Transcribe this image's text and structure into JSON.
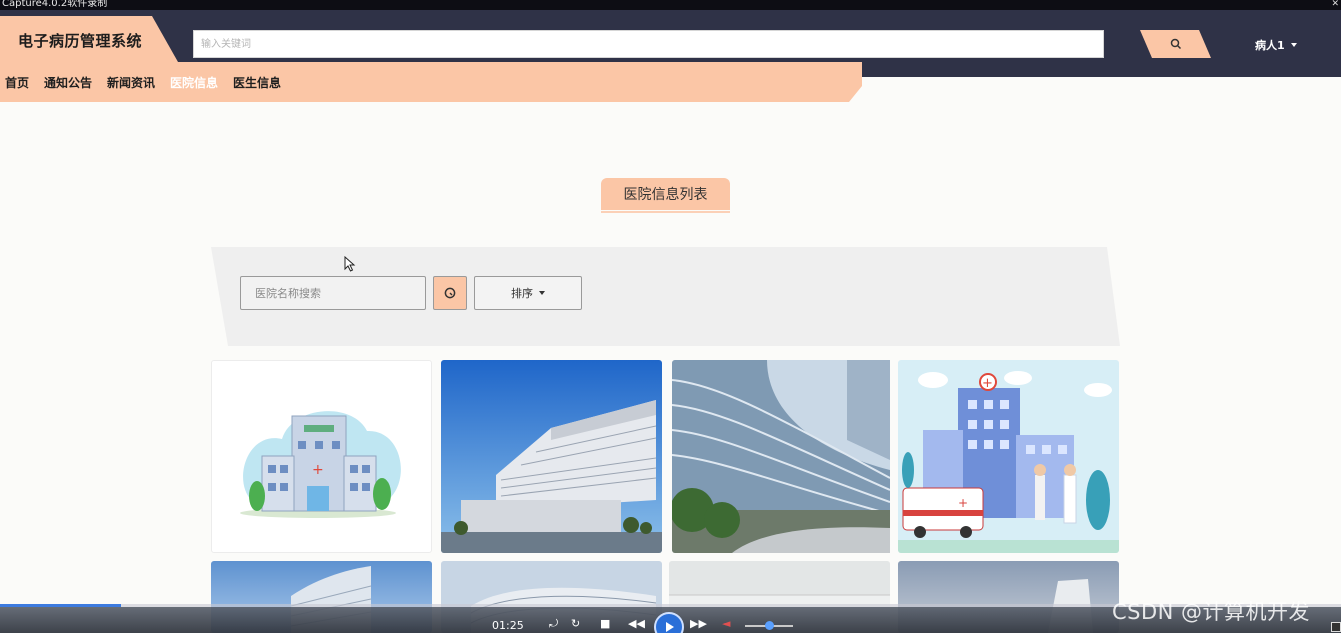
{
  "capture": {
    "title": "Capture4.0.2软件录制"
  },
  "header": {
    "brand": "电子病历管理系统",
    "search_placeholder": "输入关键词",
    "user": "病人1"
  },
  "nav": {
    "items": [
      {
        "label": "首页"
      },
      {
        "label": "通知公告"
      },
      {
        "label": "新闻资讯"
      },
      {
        "label": "医院信息",
        "active": true
      },
      {
        "label": "医生信息"
      }
    ]
  },
  "section": {
    "title": "医院信息列表"
  },
  "filter": {
    "name_placeholder": "医院名称搜索",
    "sort_label": "排序"
  },
  "cards": [
    {
      "icon": "hospital-cartoon-icon"
    },
    {
      "icon": "hospital-building-photo"
    },
    {
      "icon": "curved-hospital-photo"
    },
    {
      "icon": "hospital-ambulance-illustration"
    },
    {
      "icon": "hospital-tower-photo"
    },
    {
      "icon": "hospital-curved-photo"
    },
    {
      "icon": "hospital-fog-photo"
    },
    {
      "icon": "hospital-dusk-photo"
    }
  ],
  "player": {
    "time": "01:25",
    "progress": 0.09
  },
  "watermark": "CSDN @计算机开发",
  "colors": {
    "accent": "#fbc6a6",
    "header_bg": "#2f3247",
    "page_bg": "#fbfbf9",
    "panel_bg": "#efefef"
  }
}
